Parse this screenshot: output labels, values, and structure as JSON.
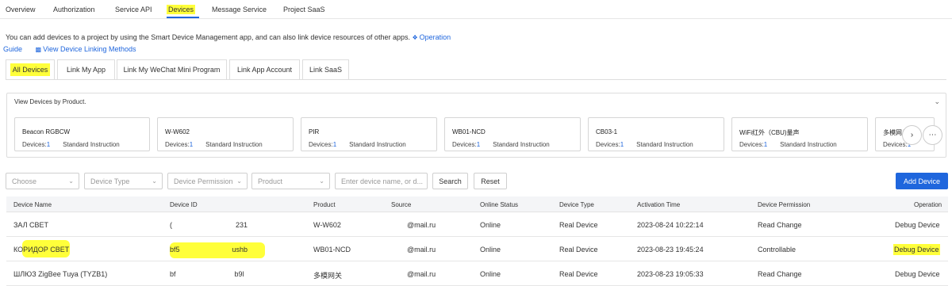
{
  "nav": [
    "Overview",
    "Authorization",
    "Service API",
    "Devices",
    "Message Service",
    "Project SaaS"
  ],
  "info": {
    "text": "You can add devices to a project by using the Smart Device Management app, and can also link device resources of other apps.",
    "op_guide_line1": "Operation",
    "op_guide_line2": "Guide",
    "linking": "View Device Linking Methods"
  },
  "tabs": [
    "All Devices",
    "Link My App",
    "Link My WeChat Mini Program",
    "Link App Account",
    "Link SaaS"
  ],
  "products": {
    "title": "View Devices by Product.",
    "devices_prefix": "Devices:",
    "items": [
      {
        "name": "Beacon RGBCW",
        "count": "1",
        "instruction": "Standard Instruction"
      },
      {
        "name": "W-W602",
        "count": "1",
        "instruction": "Standard Instruction"
      },
      {
        "name": "PIR",
        "count": "1",
        "instruction": "Standard Instruction"
      },
      {
        "name": "WB01-NCD",
        "count": "1",
        "instruction": "Standard Instruction"
      },
      {
        "name": "CB03-1",
        "count": "1",
        "instruction": "Standard Instruction"
      },
      {
        "name": "WiFi红外（CBU)量声",
        "count": "1",
        "instruction": "Standard Instruction"
      },
      {
        "name": "多模网关",
        "count": "1",
        "instruction": "Standard Instruction"
      }
    ]
  },
  "filters": {
    "choose": "Choose",
    "device_type": "Device Type",
    "device_permission": "Device Permission",
    "product": "Product",
    "search_placeholder": "Enter device name, or d...",
    "search_btn": "Search",
    "reset_btn": "Reset",
    "add_btn": "Add Device"
  },
  "table": {
    "headers": [
      "Device Name",
      "Device ID",
      "Product",
      "Source",
      "Online Status",
      "Device Type",
      "Activation Time",
      "Device Permission",
      "Operation"
    ],
    "rows": [
      {
        "name": "ЗАЛ СВЕТ",
        "id_start": "(",
        "id_end": "231",
        "product": "W-W602",
        "source": "@mail.ru",
        "status": "Online",
        "type": "Real Device",
        "time": "2023-08-24 10:22:14",
        "perm": "Read",
        "change": "Change",
        "op": "Debug Device"
      },
      {
        "name": "КОРИДОР СВЕТ",
        "id_start": "bf5",
        "id_end": "ushb",
        "product": "WB01-NCD",
        "source": "@mail.ru",
        "status": "Online",
        "type": "Real Device",
        "time": "2023-08-23 19:45:24",
        "perm": "Controllable",
        "change": "",
        "op": "Debug Device"
      },
      {
        "name": "ШЛЮЗ ZigBee Tuya (TYZB1)",
        "id_start": "bf",
        "id_end": "b9l",
        "product": "多模网关",
        "source": "@mail.ru",
        "status": "Online",
        "type": "Real Device",
        "time": "2023-08-23 19:05:33",
        "perm": "Read",
        "change": "Change",
        "op": "Debug Device"
      }
    ]
  },
  "colors": {
    "accent": "#1f66dd",
    "online": "#1fa34a",
    "highlight": "#ffff3a"
  }
}
